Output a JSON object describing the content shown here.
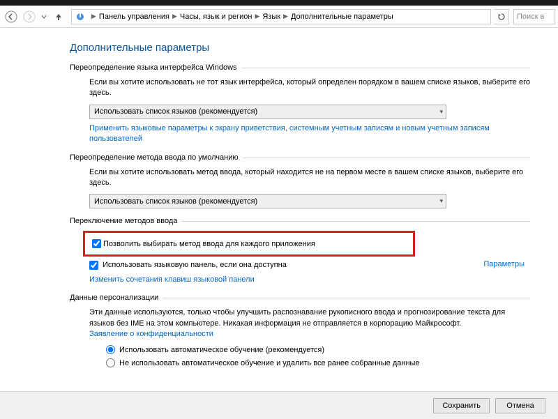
{
  "breadcrumb": {
    "items": [
      "Панель управления",
      "Часы, язык и регион",
      "Язык",
      "Дополнительные параметры"
    ]
  },
  "search": {
    "placeholder": "Поиск в"
  },
  "page_title": "Дополнительные параметры",
  "sections": {
    "ui_lang": {
      "title": "Переопределение языка интерфейса Windows",
      "desc": "Если вы хотите использовать не тот язык интерфейса, который определен порядком в вашем списке языков, выберите его здесь.",
      "dropdown": "Использовать список языков (рекомендуется)",
      "link": "Применить языковые параметры к экрану приветствия, системным учетным записям и новым учетным записям пользователей"
    },
    "input_method": {
      "title": "Переопределение метода ввода по умолчанию",
      "desc": "Если вы хотите использовать метод ввода, который находится не на первом месте в вашем списке языков, выберите его здесь.",
      "dropdown": "Использовать список языков (рекомендуется)"
    },
    "switching": {
      "title": "Переключение методов ввода",
      "check1": "Позволить выбирать метод ввода для каждого приложения",
      "check2": "Использовать языковую панель, если она доступна",
      "params_link": "Параметры",
      "link": "Изменить сочетания клавиш языковой панели"
    },
    "personalization": {
      "title": "Данные персонализации",
      "desc": "Эти данные используются, только чтобы улучшить распознавание рукописного ввода и прогнозирование текста для языков без IME на этом компьютере. Никакая информация не отправляется в корпорацию Майкрософт.",
      "privacy_link": "Заявление о конфиденциальности",
      "radio1": "Использовать автоматическое обучение (рекомендуется)",
      "radio2": "Не использовать автоматическое обучение и удалить все ранее собранные данные"
    }
  },
  "footer": {
    "save": "Сохранить",
    "cancel": "Отмена"
  }
}
